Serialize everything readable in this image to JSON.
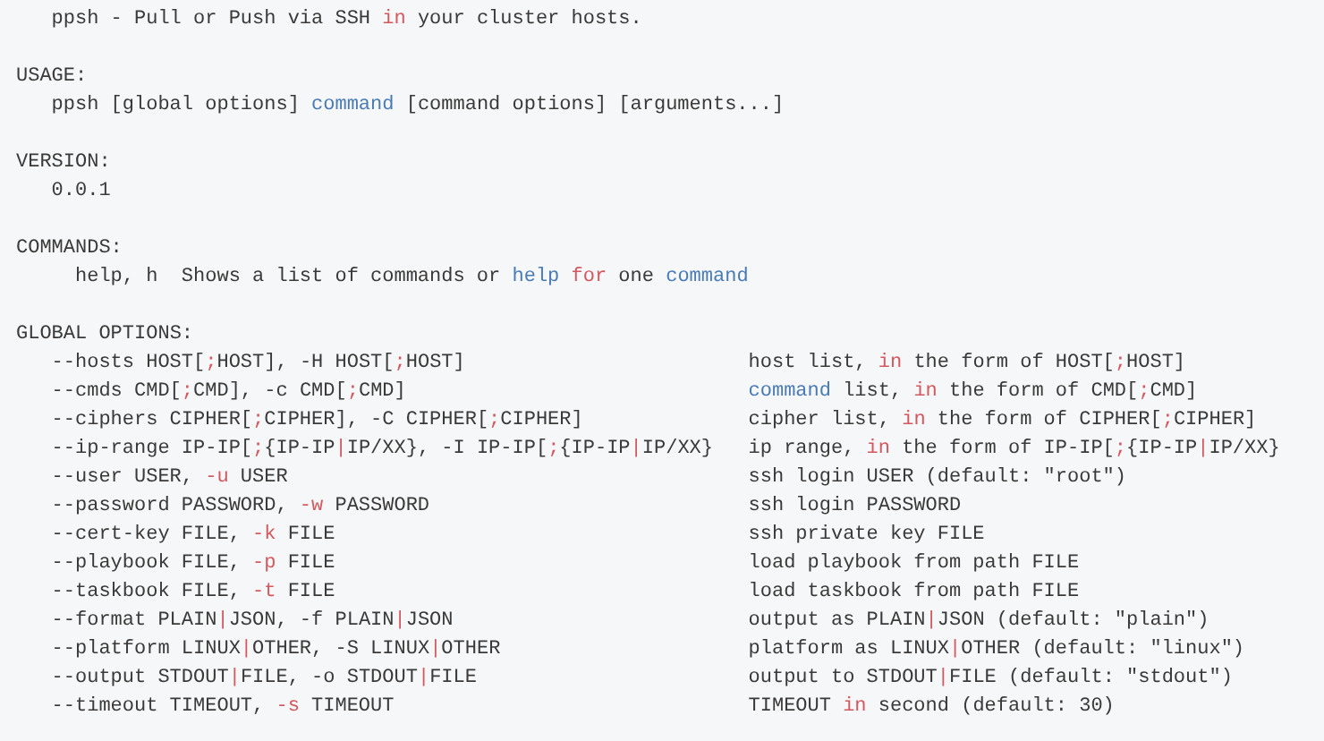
{
  "intro": [
    {
      "text": "ppsh - Pull or Push via SSH ",
      "kind": "plain"
    },
    {
      "text": "in",
      "kind": "keyword"
    },
    {
      "text": " your cluster hosts.",
      "kind": "plain"
    }
  ],
  "sections": [
    {
      "kind": "list",
      "heading": "USAGE:",
      "lines": [
        [
          {
            "text": "ppsh [global options] ",
            "kind": "plain"
          },
          {
            "text": "command",
            "kind": "name"
          },
          {
            "text": " [command options] [arguments...]",
            "kind": "plain"
          }
        ]
      ]
    },
    {
      "kind": "list",
      "heading": "VERSION:",
      "lines": [
        [
          {
            "text": "0.0.1",
            "kind": "plain"
          }
        ]
      ]
    },
    {
      "kind": "commands",
      "heading": "COMMANDS:",
      "lines": [
        [
          {
            "text": "help, h  Shows a list of commands or ",
            "kind": "plain"
          },
          {
            "text": "help ",
            "kind": "name"
          },
          {
            "text": "for",
            "kind": "keyword"
          },
          {
            "text": " one ",
            "kind": "plain"
          },
          {
            "text": "command",
            "kind": "name"
          }
        ]
      ]
    },
    {
      "kind": "options",
      "heading": "GLOBAL OPTIONS:",
      "options": [
        {
          "flags": [
            {
              "text": "--hosts HOST[",
              "kind": "plain"
            },
            {
              "text": ";",
              "kind": "keyword"
            },
            {
              "text": "HOST], -H HOST[",
              "kind": "plain"
            },
            {
              "text": ";",
              "kind": "keyword"
            },
            {
              "text": "HOST]",
              "kind": "plain"
            }
          ],
          "description": [
            {
              "text": "host list, ",
              "kind": "plain"
            },
            {
              "text": "in",
              "kind": "keyword"
            },
            {
              "text": " the form of HOST[",
              "kind": "plain"
            },
            {
              "text": ";",
              "kind": "keyword"
            },
            {
              "text": "HOST]",
              "kind": "plain"
            }
          ]
        },
        {
          "flags": [
            {
              "text": "--cmds CMD[",
              "kind": "plain"
            },
            {
              "text": ";",
              "kind": "keyword"
            },
            {
              "text": "CMD], -c CMD[",
              "kind": "plain"
            },
            {
              "text": ";",
              "kind": "keyword"
            },
            {
              "text": "CMD]",
              "kind": "plain"
            }
          ],
          "description": [
            {
              "text": "command",
              "kind": "name"
            },
            {
              "text": " list, ",
              "kind": "plain"
            },
            {
              "text": "in",
              "kind": "keyword"
            },
            {
              "text": " the form of CMD[",
              "kind": "plain"
            },
            {
              "text": ";",
              "kind": "keyword"
            },
            {
              "text": "CMD]",
              "kind": "plain"
            }
          ]
        },
        {
          "flags": [
            {
              "text": "--ciphers CIPHER[",
              "kind": "plain"
            },
            {
              "text": ";",
              "kind": "keyword"
            },
            {
              "text": "CIPHER], -C CIPHER[",
              "kind": "plain"
            },
            {
              "text": ";",
              "kind": "keyword"
            },
            {
              "text": "CIPHER]",
              "kind": "plain"
            }
          ],
          "description": [
            {
              "text": "cipher list, ",
              "kind": "plain"
            },
            {
              "text": "in",
              "kind": "keyword"
            },
            {
              "text": " the form of CIPHER[",
              "kind": "plain"
            },
            {
              "text": ";",
              "kind": "keyword"
            },
            {
              "text": "CIPHER]",
              "kind": "plain"
            }
          ]
        },
        {
          "flags": [
            {
              "text": "--ip-range IP-IP[",
              "kind": "plain"
            },
            {
              "text": ";",
              "kind": "keyword"
            },
            {
              "text": "{IP-IP",
              "kind": "plain"
            },
            {
              "text": "|",
              "kind": "keyword"
            },
            {
              "text": "IP/XX}, -I IP-IP[",
              "kind": "plain"
            },
            {
              "text": ";",
              "kind": "keyword"
            },
            {
              "text": "{IP-IP",
              "kind": "plain"
            },
            {
              "text": "|",
              "kind": "keyword"
            },
            {
              "text": "IP/XX}",
              "kind": "plain"
            }
          ],
          "description": [
            {
              "text": "ip range, ",
              "kind": "plain"
            },
            {
              "text": "in",
              "kind": "keyword"
            },
            {
              "text": " the form of IP-IP[",
              "kind": "plain"
            },
            {
              "text": ";",
              "kind": "keyword"
            },
            {
              "text": "{IP-IP",
              "kind": "plain"
            },
            {
              "text": "|",
              "kind": "keyword"
            },
            {
              "text": "IP/XX}",
              "kind": "plain"
            }
          ]
        },
        {
          "flags": [
            {
              "text": "--user USER, ",
              "kind": "plain"
            },
            {
              "text": "-u",
              "kind": "keyword"
            },
            {
              "text": " USER",
              "kind": "plain"
            }
          ],
          "description": [
            {
              "text": "ssh login USER (default: \"root\")",
              "kind": "plain"
            }
          ]
        },
        {
          "flags": [
            {
              "text": "--password PASSWORD, ",
              "kind": "plain"
            },
            {
              "text": "-w",
              "kind": "keyword"
            },
            {
              "text": " PASSWORD",
              "kind": "plain"
            }
          ],
          "description": [
            {
              "text": "ssh login PASSWORD",
              "kind": "plain"
            }
          ]
        },
        {
          "flags": [
            {
              "text": "--cert-key FILE, ",
              "kind": "plain"
            },
            {
              "text": "-k",
              "kind": "keyword"
            },
            {
              "text": " FILE",
              "kind": "plain"
            }
          ],
          "description": [
            {
              "text": "ssh private key FILE",
              "kind": "plain"
            }
          ]
        },
        {
          "flags": [
            {
              "text": "--playbook FILE, ",
              "kind": "plain"
            },
            {
              "text": "-p",
              "kind": "keyword"
            },
            {
              "text": " FILE",
              "kind": "plain"
            }
          ],
          "description": [
            {
              "text": "load playbook from path FILE",
              "kind": "plain"
            }
          ]
        },
        {
          "flags": [
            {
              "text": "--taskbook FILE, ",
              "kind": "plain"
            },
            {
              "text": "-t",
              "kind": "keyword"
            },
            {
              "text": " FILE",
              "kind": "plain"
            }
          ],
          "description": [
            {
              "text": "load taskbook from path FILE",
              "kind": "plain"
            }
          ]
        },
        {
          "flags": [
            {
              "text": "--format PLAIN",
              "kind": "plain"
            },
            {
              "text": "|",
              "kind": "keyword"
            },
            {
              "text": "JSON, -f PLAIN",
              "kind": "plain"
            },
            {
              "text": "|",
              "kind": "keyword"
            },
            {
              "text": "JSON",
              "kind": "plain"
            }
          ],
          "description": [
            {
              "text": "output as PLAIN",
              "kind": "plain"
            },
            {
              "text": "|",
              "kind": "keyword"
            },
            {
              "text": "JSON (default: \"plain\")",
              "kind": "plain"
            }
          ]
        },
        {
          "flags": [
            {
              "text": "--platform LINUX",
              "kind": "plain"
            },
            {
              "text": "|",
              "kind": "keyword"
            },
            {
              "text": "OTHER, -S LINUX",
              "kind": "plain"
            },
            {
              "text": "|",
              "kind": "keyword"
            },
            {
              "text": "OTHER",
              "kind": "plain"
            }
          ],
          "description": [
            {
              "text": "platform as LINUX",
              "kind": "plain"
            },
            {
              "text": "|",
              "kind": "keyword"
            },
            {
              "text": "OTHER (default: \"linux\")",
              "kind": "plain"
            }
          ]
        },
        {
          "flags": [
            {
              "text": "--output STDOUT",
              "kind": "plain"
            },
            {
              "text": "|",
              "kind": "keyword"
            },
            {
              "text": "FILE, -o STDOUT",
              "kind": "plain"
            },
            {
              "text": "|",
              "kind": "keyword"
            },
            {
              "text": "FILE",
              "kind": "plain"
            }
          ],
          "description": [
            {
              "text": "output to STDOUT",
              "kind": "plain"
            },
            {
              "text": "|",
              "kind": "keyword"
            },
            {
              "text": "FILE (default: \"stdout\")",
              "kind": "plain"
            }
          ]
        },
        {
          "flags": [
            {
              "text": "--timeout TIMEOUT, ",
              "kind": "plain"
            },
            {
              "text": "-s",
              "kind": "keyword"
            },
            {
              "text": " TIMEOUT",
              "kind": "plain"
            }
          ],
          "description": [
            {
              "text": "TIMEOUT ",
              "kind": "plain"
            },
            {
              "text": "in",
              "kind": "keyword"
            },
            {
              "text": " second (default: 30)",
              "kind": "plain"
            }
          ]
        }
      ]
    }
  ]
}
